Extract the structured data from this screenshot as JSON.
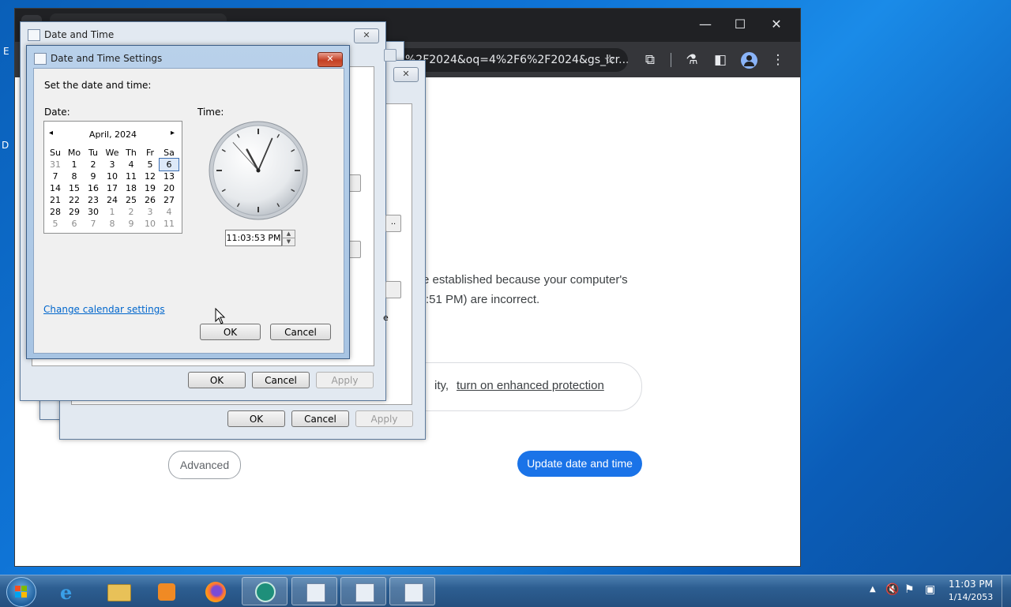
{
  "browser": {
    "omnibox_text": "%2F2024&oq=4%2F6%2F2024&gs_lcr...",
    "window_controls": {
      "minimize": "—",
      "maximize": "☐",
      "close": "✕"
    },
    "toolbar_icons": [
      "star-icon",
      "extensions-icon",
      "labs-icon",
      "side-panel-icon",
      "profile-icon",
      "menu-icon"
    ],
    "content": {
      "error_line1": "e established because your computer's",
      "error_line2": ":51 PM) are incorrect.",
      "enhanced_prefix": "ity, ",
      "enhanced_link": "turn on enhanced protection",
      "advanced_button": "Advanced",
      "update_button": "Update date and time"
    }
  },
  "date_time_dialog": {
    "title": "Date and Time",
    "ok": "OK",
    "cancel": "Cancel",
    "apply": "Apply",
    "partial_button": "..",
    "partial_letter": "e"
  },
  "second_dialog": {
    "ok": "OK",
    "cancel": "Cancel",
    "apply": "Apply"
  },
  "settings_dialog": {
    "title": "Date and Time Settings",
    "instruction": "Set the date and time:",
    "date_label": "Date:",
    "time_label": "Time:",
    "calendar": {
      "month_year": "April, 2024",
      "prev": "◂",
      "next": "▸",
      "weekdays": [
        "Su",
        "Mo",
        "Tu",
        "We",
        "Th",
        "Fr",
        "Sa"
      ],
      "weeks": [
        [
          {
            "d": "31",
            "dim": true
          },
          {
            "d": "1"
          },
          {
            "d": "2"
          },
          {
            "d": "3"
          },
          {
            "d": "4"
          },
          {
            "d": "5"
          },
          {
            "d": "6",
            "sel": true
          }
        ],
        [
          {
            "d": "7"
          },
          {
            "d": "8"
          },
          {
            "d": "9"
          },
          {
            "d": "10"
          },
          {
            "d": "11"
          },
          {
            "d": "12"
          },
          {
            "d": "13"
          }
        ],
        [
          {
            "d": "14"
          },
          {
            "d": "15"
          },
          {
            "d": "16"
          },
          {
            "d": "17"
          },
          {
            "d": "18"
          },
          {
            "d": "19"
          },
          {
            "d": "20"
          }
        ],
        [
          {
            "d": "21"
          },
          {
            "d": "22"
          },
          {
            "d": "23"
          },
          {
            "d": "24"
          },
          {
            "d": "25"
          },
          {
            "d": "26"
          },
          {
            "d": "27"
          }
        ],
        [
          {
            "d": "28"
          },
          {
            "d": "29"
          },
          {
            "d": "30"
          },
          {
            "d": "1",
            "dim": true
          },
          {
            "d": "2",
            "dim": true
          },
          {
            "d": "3",
            "dim": true
          },
          {
            "d": "4",
            "dim": true
          }
        ],
        [
          {
            "d": "5",
            "dim": true
          },
          {
            "d": "6",
            "dim": true
          },
          {
            "d": "7",
            "dim": true
          },
          {
            "d": "8",
            "dim": true
          },
          {
            "d": "9",
            "dim": true
          },
          {
            "d": "10",
            "dim": true
          },
          {
            "d": "11",
            "dim": true
          }
        ]
      ]
    },
    "time_value": "11:03:53 PM",
    "clock": {
      "hour": 11,
      "minute": 3,
      "second": 53
    },
    "change_calendar_link": "Change calendar settings",
    "ok": "OK",
    "cancel": "Cancel"
  },
  "taskbar": {
    "apps": [
      "internet-explorer-icon",
      "file-explorer-icon",
      "media-player-icon",
      "firefox-icon",
      "chrome-icon",
      "date-time-window-icon",
      "date-time-window-icon",
      "date-time-window-icon"
    ],
    "clock_time": "11:03 PM",
    "clock_date": "1/14/2053"
  },
  "desktop_edge_letters": [
    "E",
    "D"
  ]
}
